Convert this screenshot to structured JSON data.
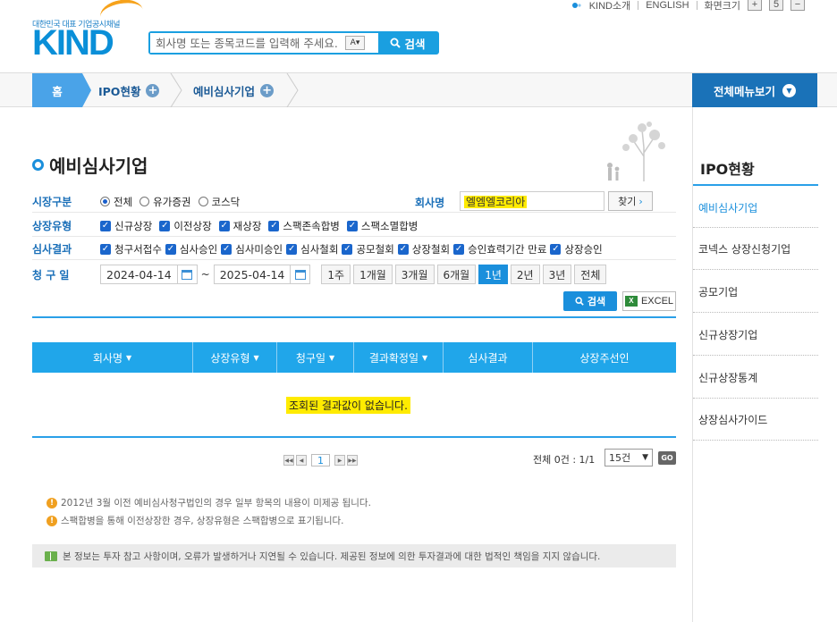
{
  "header": {
    "logo_tagline": "대한민국 대표 기업공시채널",
    "logo_text": "KIND",
    "search_placeholder": "회사명 또는 종목코드를 입력해 주세요.",
    "search_option": "A",
    "search_button": "검색",
    "links": [
      "KIND소개",
      "ENGLISH",
      "화면크기"
    ],
    "size_buttons": [
      "+",
      "5",
      "−"
    ]
  },
  "nav": {
    "home": "홈",
    "crumbs": [
      "IPO현황",
      "예비심사기업"
    ],
    "menu_all": "전체메뉴보기"
  },
  "sidebar": {
    "title": "IPO현황",
    "items": [
      "예비심사기업",
      "코넥스 상장신청기업",
      "공모기업",
      "신규상장기업",
      "신규상장통계",
      "상장심사가이드"
    ]
  },
  "page": {
    "title": "예비심사기업"
  },
  "filters": {
    "market": {
      "label": "시장구분",
      "options": [
        {
          "text": "전체",
          "checked": true
        },
        {
          "text": "유가증권",
          "checked": false
        },
        {
          "text": "코스닥",
          "checked": false
        }
      ]
    },
    "company": {
      "label": "회사명",
      "value": "엘엠엘코리아",
      "find_button": "찾기"
    },
    "listing_type": {
      "label": "상장유형",
      "options": [
        "신규상장",
        "이전상장",
        "재상장",
        "스팩존속합병",
        "스팩소멸합병"
      ]
    },
    "review_result": {
      "label": "심사결과",
      "options": [
        "청구서접수",
        "심사승인",
        "심사미승인",
        "심사철회",
        "공모철회",
        "상장철회",
        "승인효력기간 만료",
        "상장승인"
      ]
    },
    "request_date": {
      "label": "청 구 일",
      "from": "2024-04-14",
      "tilde": "~",
      "to": "2025-04-14",
      "periods": [
        "1주",
        "1개월",
        "3개월",
        "6개월",
        "1년",
        "2년",
        "3년",
        "전체"
      ],
      "selected_period": "1년"
    },
    "search_button": "검색",
    "excel_button": "EXCEL"
  },
  "table": {
    "columns": [
      "회사명",
      "상장유형",
      "청구일",
      "결과확정일",
      "심사결과",
      "상장주선인"
    ],
    "empty_message": "조회된 결과값이 없습니다."
  },
  "pagination": {
    "current_page": "1",
    "total_text": "전체 0건 : 1/1",
    "per_page": "15건",
    "go": "GO"
  },
  "notes": [
    "2012년 3월 이전 예비심사청구법인의 경우 일부 항목의 내용이 미제공 됩니다.",
    "스팩합병을 통해 이전상장한 경우, 상장유형은 스팩합병으로 표기됩니다."
  ],
  "disclaimer": "본 정보는 투자 참고 사항이며, 오류가 발생하거나 지연될 수 있습니다. 제공된 정보에 의한 투자결과에 대한 법적인 책임을 지지 않습니다.",
  "colors": {
    "accent": "#1a8fdc",
    "header_blue": "#20a6ea",
    "highlight": "#ffeb00",
    "nav_dark": "#1a72b8"
  }
}
